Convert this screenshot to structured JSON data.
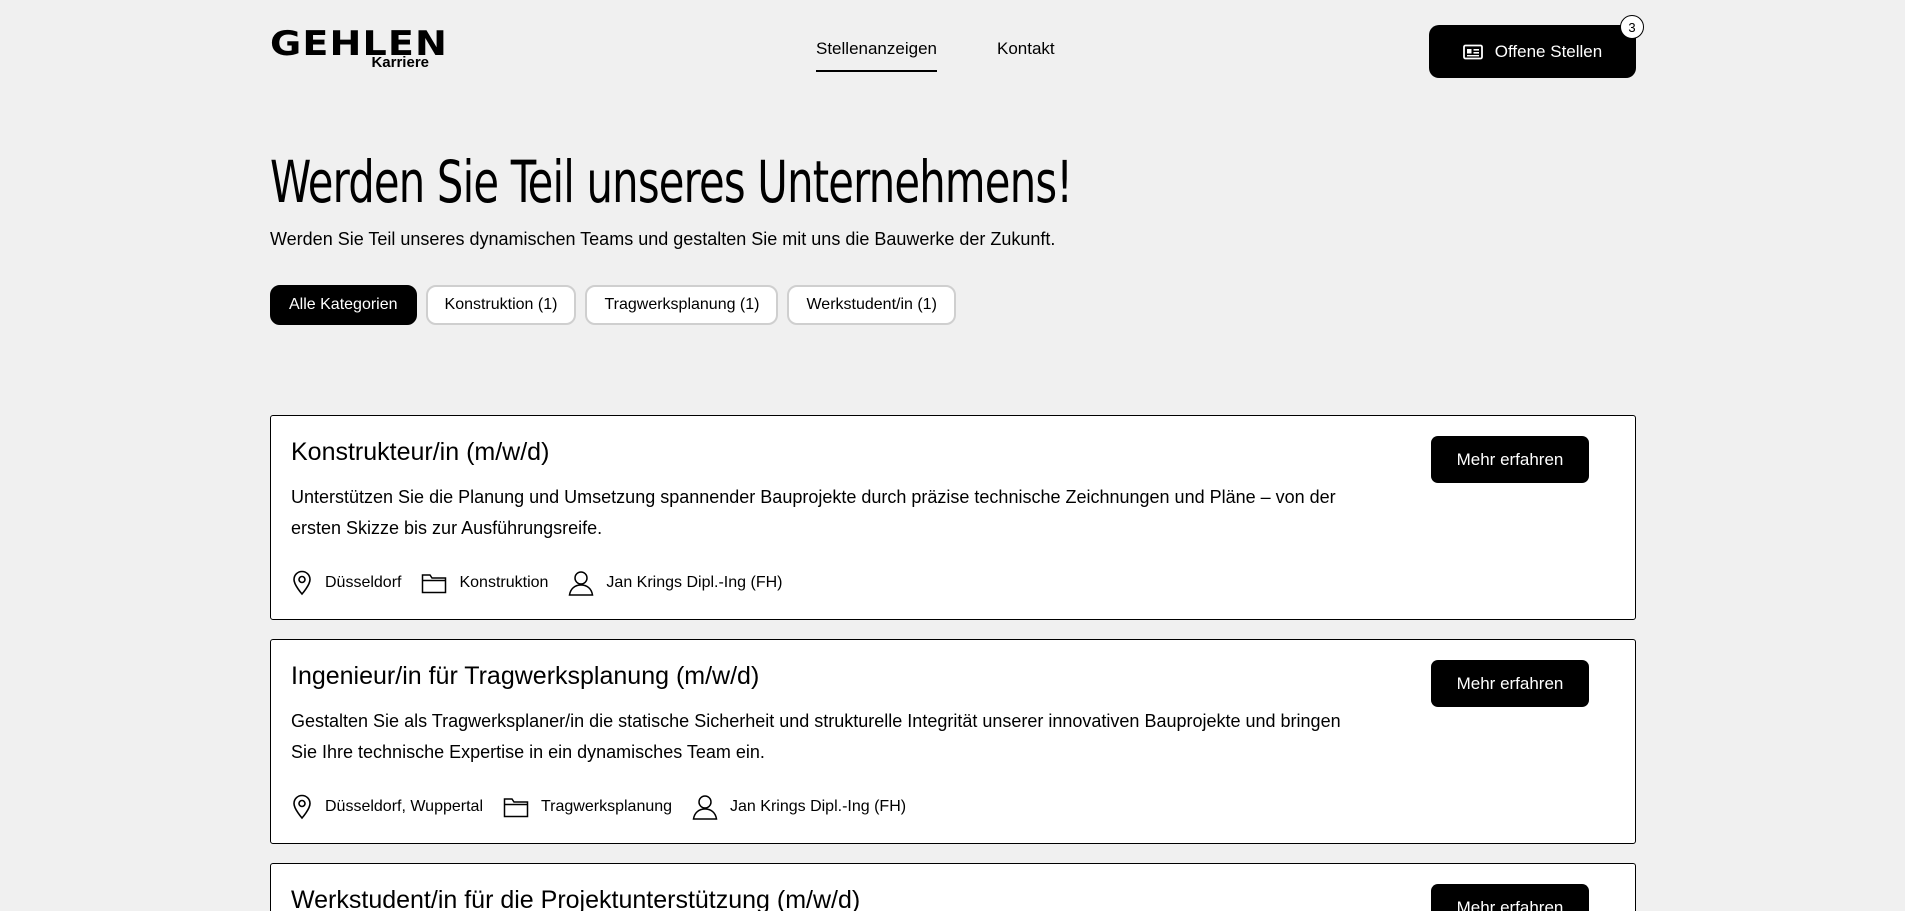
{
  "brand": {
    "name": "GEHLEN",
    "sub": "Karriere"
  },
  "nav": {
    "items": [
      {
        "label": "Stellenanzeigen"
      },
      {
        "label": "Kontakt"
      }
    ]
  },
  "cta": {
    "label": "Offene Stellen",
    "count": "3"
  },
  "hero": {
    "title": "Werden Sie Teil unseres Unternehmens!",
    "subtitle": "Werden Sie Teil unseres dynamischen Teams und gestalten Sie mit uns die Bauwerke der Zukunft."
  },
  "filters": [
    {
      "label": "Alle Kategorien"
    },
    {
      "label": "Konstruktion (1)"
    },
    {
      "label": "Tragwerksplanung (1)"
    },
    {
      "label": "Werkstudent/in (1)"
    }
  ],
  "jobs": [
    {
      "title": "Konstrukteur/in (m/w/d)",
      "description": "Unterstützen Sie die Planung und Umsetzung spannender Bauprojekte durch präzise technische Zeichnungen und Pläne – von der ersten Skizze bis zur Ausführungsreife.",
      "location": "Düsseldorf",
      "category": "Konstruktion",
      "contact": "Jan Krings Dipl.-Ing (FH)",
      "button": "Mehr erfahren"
    },
    {
      "title": "Ingenieur/in für Tragwerksplanung (m/w/d)",
      "description": "Gestalten Sie als Tragwerksplaner/in die statische Sicherheit und strukturelle Integrität unserer innovativen Bauprojekte und bringen Sie Ihre technische Expertise in ein dynamisches Team ein.",
      "location": "Düsseldorf, Wuppertal",
      "category": "Tragwerksplanung",
      "contact": "Jan Krings Dipl.-Ing (FH)",
      "button": "Mehr erfahren"
    },
    {
      "title": "Werkstudent/in für die Projektunterstützung (m/w/d)",
      "button": "Mehr erfahren"
    }
  ],
  "icons": {
    "location": "map-pin-icon",
    "category": "folder-icon",
    "contact": "user-icon",
    "cta": "id-card-icon"
  }
}
